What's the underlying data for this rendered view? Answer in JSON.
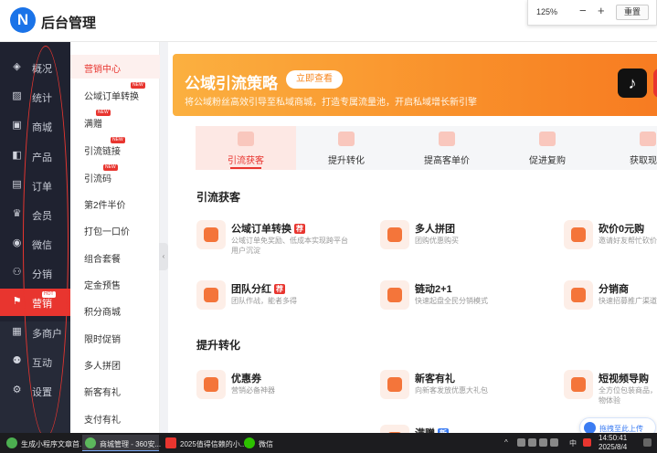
{
  "header": {
    "logo_letter": "N",
    "brand": "后台管理",
    "zoom": {
      "level": "125%",
      "minus": "−",
      "plus": "+",
      "reset": "重置"
    }
  },
  "sidebar": {
    "items": [
      {
        "label": "概况",
        "icon": "layers-icon",
        "glyph": "◈"
      },
      {
        "label": "统计",
        "icon": "chart-icon",
        "glyph": "▨"
      },
      {
        "label": "商城",
        "icon": "store-icon",
        "glyph": "▣"
      },
      {
        "label": "产品",
        "icon": "product-icon",
        "glyph": "◧"
      },
      {
        "label": "订单",
        "icon": "order-icon",
        "glyph": "▤"
      },
      {
        "label": "会员",
        "icon": "crown-icon",
        "glyph": "♛"
      },
      {
        "label": "微信",
        "icon": "wechat-icon",
        "glyph": "◉"
      },
      {
        "label": "分销",
        "icon": "distribution-icon",
        "glyph": "⚇"
      },
      {
        "label": "营销",
        "icon": "flag-icon",
        "glyph": "⚑",
        "badge": "HOT"
      },
      {
        "label": "多商户",
        "icon": "shop-icon",
        "glyph": "▦"
      },
      {
        "label": "互动",
        "icon": "users-icon",
        "glyph": "⚉"
      },
      {
        "label": "设置",
        "icon": "gear-icon",
        "glyph": "⚙"
      }
    ]
  },
  "submenu": {
    "items": [
      {
        "label": "营销中心"
      },
      {
        "label": "公域订单转换",
        "tag": "NEW"
      },
      {
        "label": "满赠",
        "tag": "NEW"
      },
      {
        "label": "引流链接",
        "tag": "NEW"
      },
      {
        "label": "引流码",
        "tag": "NEW"
      },
      {
        "label": "第2件半价"
      },
      {
        "label": "打包一口价"
      },
      {
        "label": "组合套餐"
      },
      {
        "label": "定金预售"
      },
      {
        "label": "积分商城"
      },
      {
        "label": "限时促销"
      },
      {
        "label": "多人拼团"
      },
      {
        "label": "新客有礼"
      },
      {
        "label": "支付有礼"
      }
    ]
  },
  "banner": {
    "title": "公域引流策略",
    "button": "立即查看",
    "desc": "将公域粉丝高效引导至私域商城，打造专属流量池，开启私域增长新引擎"
  },
  "tabs": [
    {
      "label": "引流获客"
    },
    {
      "label": "提升转化"
    },
    {
      "label": "提高客单价"
    },
    {
      "label": "促进复购"
    },
    {
      "label": "获取现金"
    }
  ],
  "sections": {
    "acquire": {
      "title": "引流获客",
      "cards": [
        {
          "title": "公域订单转换",
          "tag": "荐",
          "desc": "公域订单免奖励、低成本实现跨平台用户沉淀",
          "icon": "order-transfer-icon"
        },
        {
          "title": "多人拼团",
          "desc": "团购优惠购买",
          "icon": "group-buy-icon"
        },
        {
          "title": "砍价0元购",
          "desc": "邀请好友帮忙砍价",
          "icon": "bargain-icon"
        },
        {
          "title": "团队分红",
          "tag": "荐",
          "desc": "团队作战，能者多得",
          "icon": "team-bonus-icon"
        },
        {
          "title": "链动2+1",
          "desc": "快速起盘全民分销模式",
          "icon": "chain-icon"
        },
        {
          "title": "分销商",
          "desc": "快速招募推广渠道",
          "icon": "distributor-icon"
        }
      ]
    },
    "convert": {
      "title": "提升转化",
      "cards": [
        {
          "title": "优惠券",
          "desc": "营销必备神器",
          "icon": "coupon-icon"
        },
        {
          "title": "新客有礼",
          "desc": "向新客发放优惠大礼包",
          "icon": "gift-icon"
        },
        {
          "title": "短视频导购",
          "desc": "全方位包装商品，物体验",
          "icon": "video-icon"
        },
        {
          "title": "满赠",
          "tag": "新",
          "desc": "",
          "icon": "full-gift-icon"
        }
      ]
    }
  },
  "feedback": "拖拽至此上传",
  "taskbar": {
    "tasks": [
      {
        "label": "生成小程序文章首..."
      },
      {
        "label": "商城管理 - 360安..."
      },
      {
        "label": "2025值得信赖的小..."
      },
      {
        "label": "微信"
      }
    ],
    "tray": {
      "ime": "中",
      "time": "14:50:41",
      "date": "2025/8/4"
    }
  },
  "colors": {
    "accent": "#e8352f",
    "banner_orange": "#f98f2a",
    "sidebar_bg": "#1f2230",
    "link_blue": "#3b7cf2"
  }
}
